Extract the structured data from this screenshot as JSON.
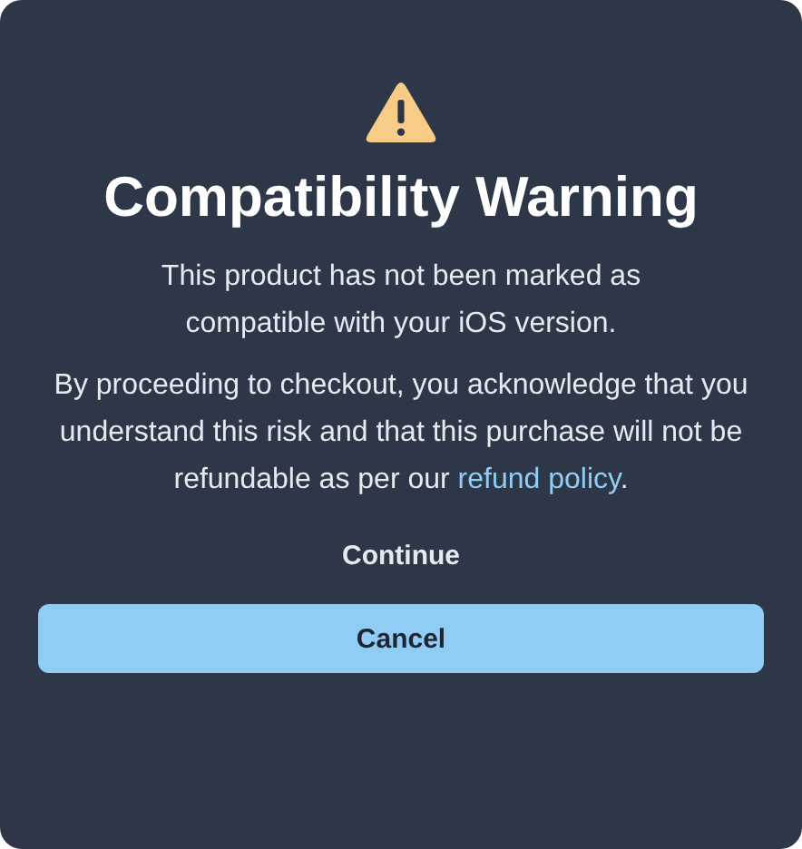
{
  "dialog": {
    "title": "Compatibility Warning",
    "message": "This product has not been marked as compatible with your iOS version.",
    "notice": {
      "text": "By proceeding to checkout, you acknowledge that you understand this risk and that this purchase will not be refundable as per our ",
      "link": "refund policy",
      "suffix": "."
    },
    "continue_button": "Continue",
    "cancel_button": "Cancel"
  }
}
